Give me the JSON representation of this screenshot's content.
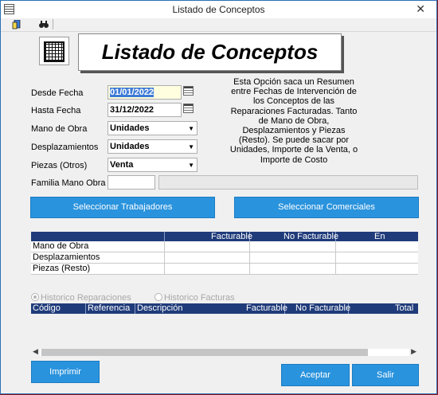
{
  "window": {
    "title": "Listado de Conceptos",
    "close_glyph": "✕"
  },
  "toolbar": {
    "buttons": [
      {
        "icon": "report-icon"
      },
      {
        "icon": "binoculars-icon"
      }
    ]
  },
  "banner": {
    "title": "Listado de Conceptos"
  },
  "form": {
    "desde_label": "Desde Fecha",
    "desde_value": "01/01/2022",
    "hasta_label": "Hasta Fecha",
    "hasta_value": "31/12/2022",
    "mano_obra_label": "Mano de Obra",
    "mano_obra_value": "Unidades",
    "desplaz_label": "Desplazamientos",
    "desplaz_value": "Unidades",
    "piezas_label": "Piezas (Otros)",
    "piezas_value": "Venta",
    "familia_label": "Familia Mano Obra"
  },
  "description": "Esta Opción saca un Resumen entre Fechas de Intervención de los Conceptos de las Reparaciones Facturadas. Tanto de Mano de Obra, Desplazamientos y Piezas (Resto). Se puede sacar por Unidades, Importe de la Venta, o Importe de Costo",
  "buttons": {
    "trabajadores": "Seleccionar Trabajadores",
    "comerciales": "Seleccionar Comerciales",
    "imprimir": "Imprimir",
    "aceptar": "Aceptar",
    "salir": "Salir"
  },
  "summary_table": {
    "columns": [
      "",
      "Facturable",
      "No Facturable",
      "En Garantia"
    ],
    "rows": [
      "Mano de Obra",
      "Desplazamientos",
      "Piezas (Resto)"
    ]
  },
  "radios": {
    "historico_reparaciones": "Historico Reparaciones",
    "historico_facturas": "Historico Facturas",
    "selected": "historico_reparaciones"
  },
  "detail_table": {
    "columns": [
      "Código",
      "Referencia",
      "Descripción",
      "Facturable",
      "No Facturable",
      "Total"
    ]
  },
  "colors": {
    "accent_button": "#2a93dd",
    "grid_header": "#1f3b7a",
    "desktop": "#8f1b1b"
  }
}
